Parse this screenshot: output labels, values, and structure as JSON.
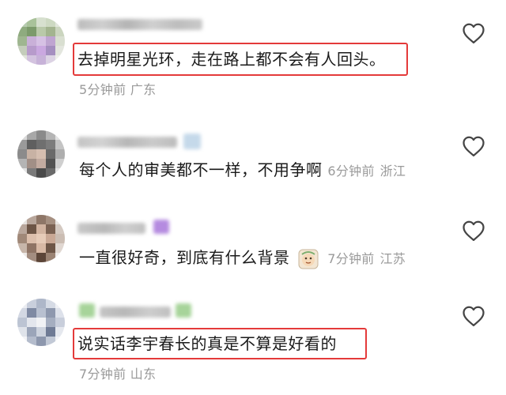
{
  "comments": [
    {
      "text": "去掉明星光环，走在路上都不会有人回头。",
      "time": "5分钟前",
      "location": "广东"
    },
    {
      "text": "每个人的审美都不一样，不用争啊",
      "time": "6分钟前",
      "location": "浙江"
    },
    {
      "text": "一直很好奇，到底有什么背景",
      "time": "7分钟前",
      "location": "江苏"
    },
    {
      "text": "说实话李宇春长的真是不算是好看的",
      "time": "7分钟前",
      "location": "山东"
    }
  ],
  "icons": {
    "like": "heart-outline-icon",
    "sticker": "sticker-icon"
  },
  "colors": {
    "highlight": "#e43a3a",
    "meta": "#9a9a9a",
    "text": "#1a1a1a"
  }
}
